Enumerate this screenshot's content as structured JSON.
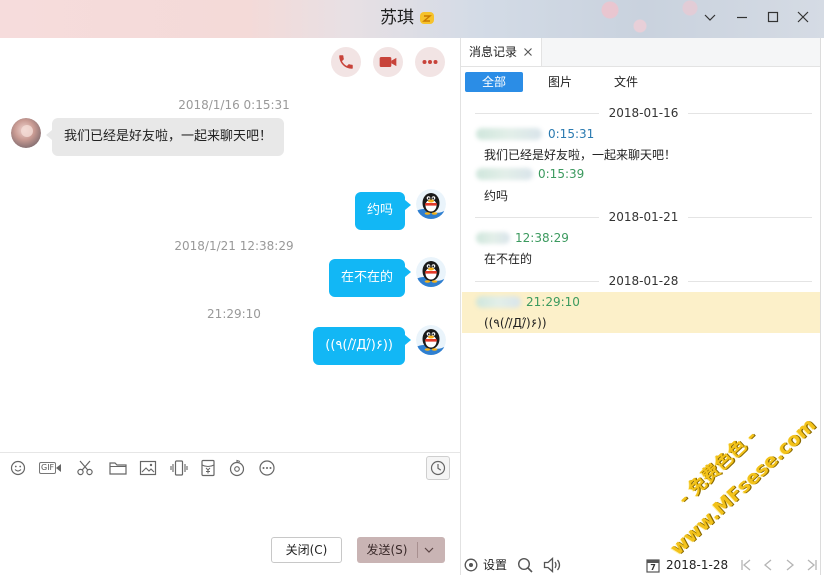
{
  "window": {
    "title": "苏琪",
    "title_badge_icon": "vip-badge-icon",
    "controls": [
      "chevron-down-icon",
      "minimize-icon",
      "maximize-icon",
      "close-icon"
    ]
  },
  "colors": {
    "accent_blue": "#12b7f5",
    "filter_active_blue": "#2b8de6",
    "call_icon_red": "#c8433a",
    "timestamp_gray": "#999999",
    "incoming_bubble": "#e8e8e8",
    "history_other_time": "#2a7ab0",
    "history_self_time": "#3c9a5f",
    "history_highlight": "#fcf0c9",
    "send_button": "#c9b4b4",
    "watermark_yellow": "#f3c21a"
  },
  "call_actions": [
    {
      "icon": "phone-icon"
    },
    {
      "icon": "video-icon"
    },
    {
      "icon": "more-dots-icon"
    }
  ],
  "chat": {
    "timestamps": [
      "2018/1/16 0:15:31",
      "2018/1/21 12:38:29",
      "21:29:10"
    ],
    "messages": [
      {
        "direction": "incoming",
        "text": "我们已经是好友啦，一起来聊天吧！"
      },
      {
        "direction": "outgoing",
        "text": "约吗"
      },
      {
        "direction": "outgoing",
        "text": "在不在的"
      },
      {
        "direction": "outgoing",
        "text": "((٩(//̀Д/́)۶))"
      }
    ]
  },
  "toolbar": {
    "icons": [
      "emoji-icon",
      "gif-icon",
      "scissors-icon",
      "folder-icon",
      "image-icon",
      "shake-icon",
      "red-packet-icon",
      "music-icon",
      "more-icon"
    ],
    "gif_label": "GIF",
    "history_icon": "clock-icon"
  },
  "composer": {
    "value": ""
  },
  "buttons": {
    "close_label": "关闭(C)",
    "send_label": "发送(S)",
    "send_menu_icon": "chevron-down-icon"
  },
  "history": {
    "tab_label": "消息记录",
    "tab_close_icon": "close-small-icon",
    "filters": [
      {
        "label": "全部",
        "active": true
      },
      {
        "label": "图片",
        "active": false
      },
      {
        "label": "文件",
        "active": false
      }
    ],
    "groups": [
      {
        "date": "2018-01-16",
        "entries": [
          {
            "sender": "other",
            "time": "0:15:31",
            "text": "我们已经是好友啦，一起来聊天吧！"
          },
          {
            "sender": "self",
            "time": "0:15:39",
            "text": "约吗"
          }
        ]
      },
      {
        "date": "2018-01-21",
        "entries": [
          {
            "sender": "self",
            "time": "12:38:29",
            "text": "在不在的"
          }
        ]
      },
      {
        "date": "2018-01-28",
        "entries": [
          {
            "sender": "self",
            "time": "21:29:10",
            "text": "((٩(//̀Д/́)۶))",
            "highlighted": true
          }
        ]
      }
    ],
    "footer": {
      "settings_icon": "settings-icon",
      "settings_label": "设置",
      "search_icon": "search-icon",
      "voice_icon": "speaker-icon",
      "calendar_icon": "calendar-icon",
      "calendar_day": "7",
      "date": "2018-1-28",
      "nav_icons": [
        "first-page-icon",
        "prev-page-icon",
        "next-page-icon",
        "last-page-icon"
      ]
    }
  },
  "watermark": {
    "line1": "- 免费色色 -",
    "line2": "www.MFsese.com"
  }
}
